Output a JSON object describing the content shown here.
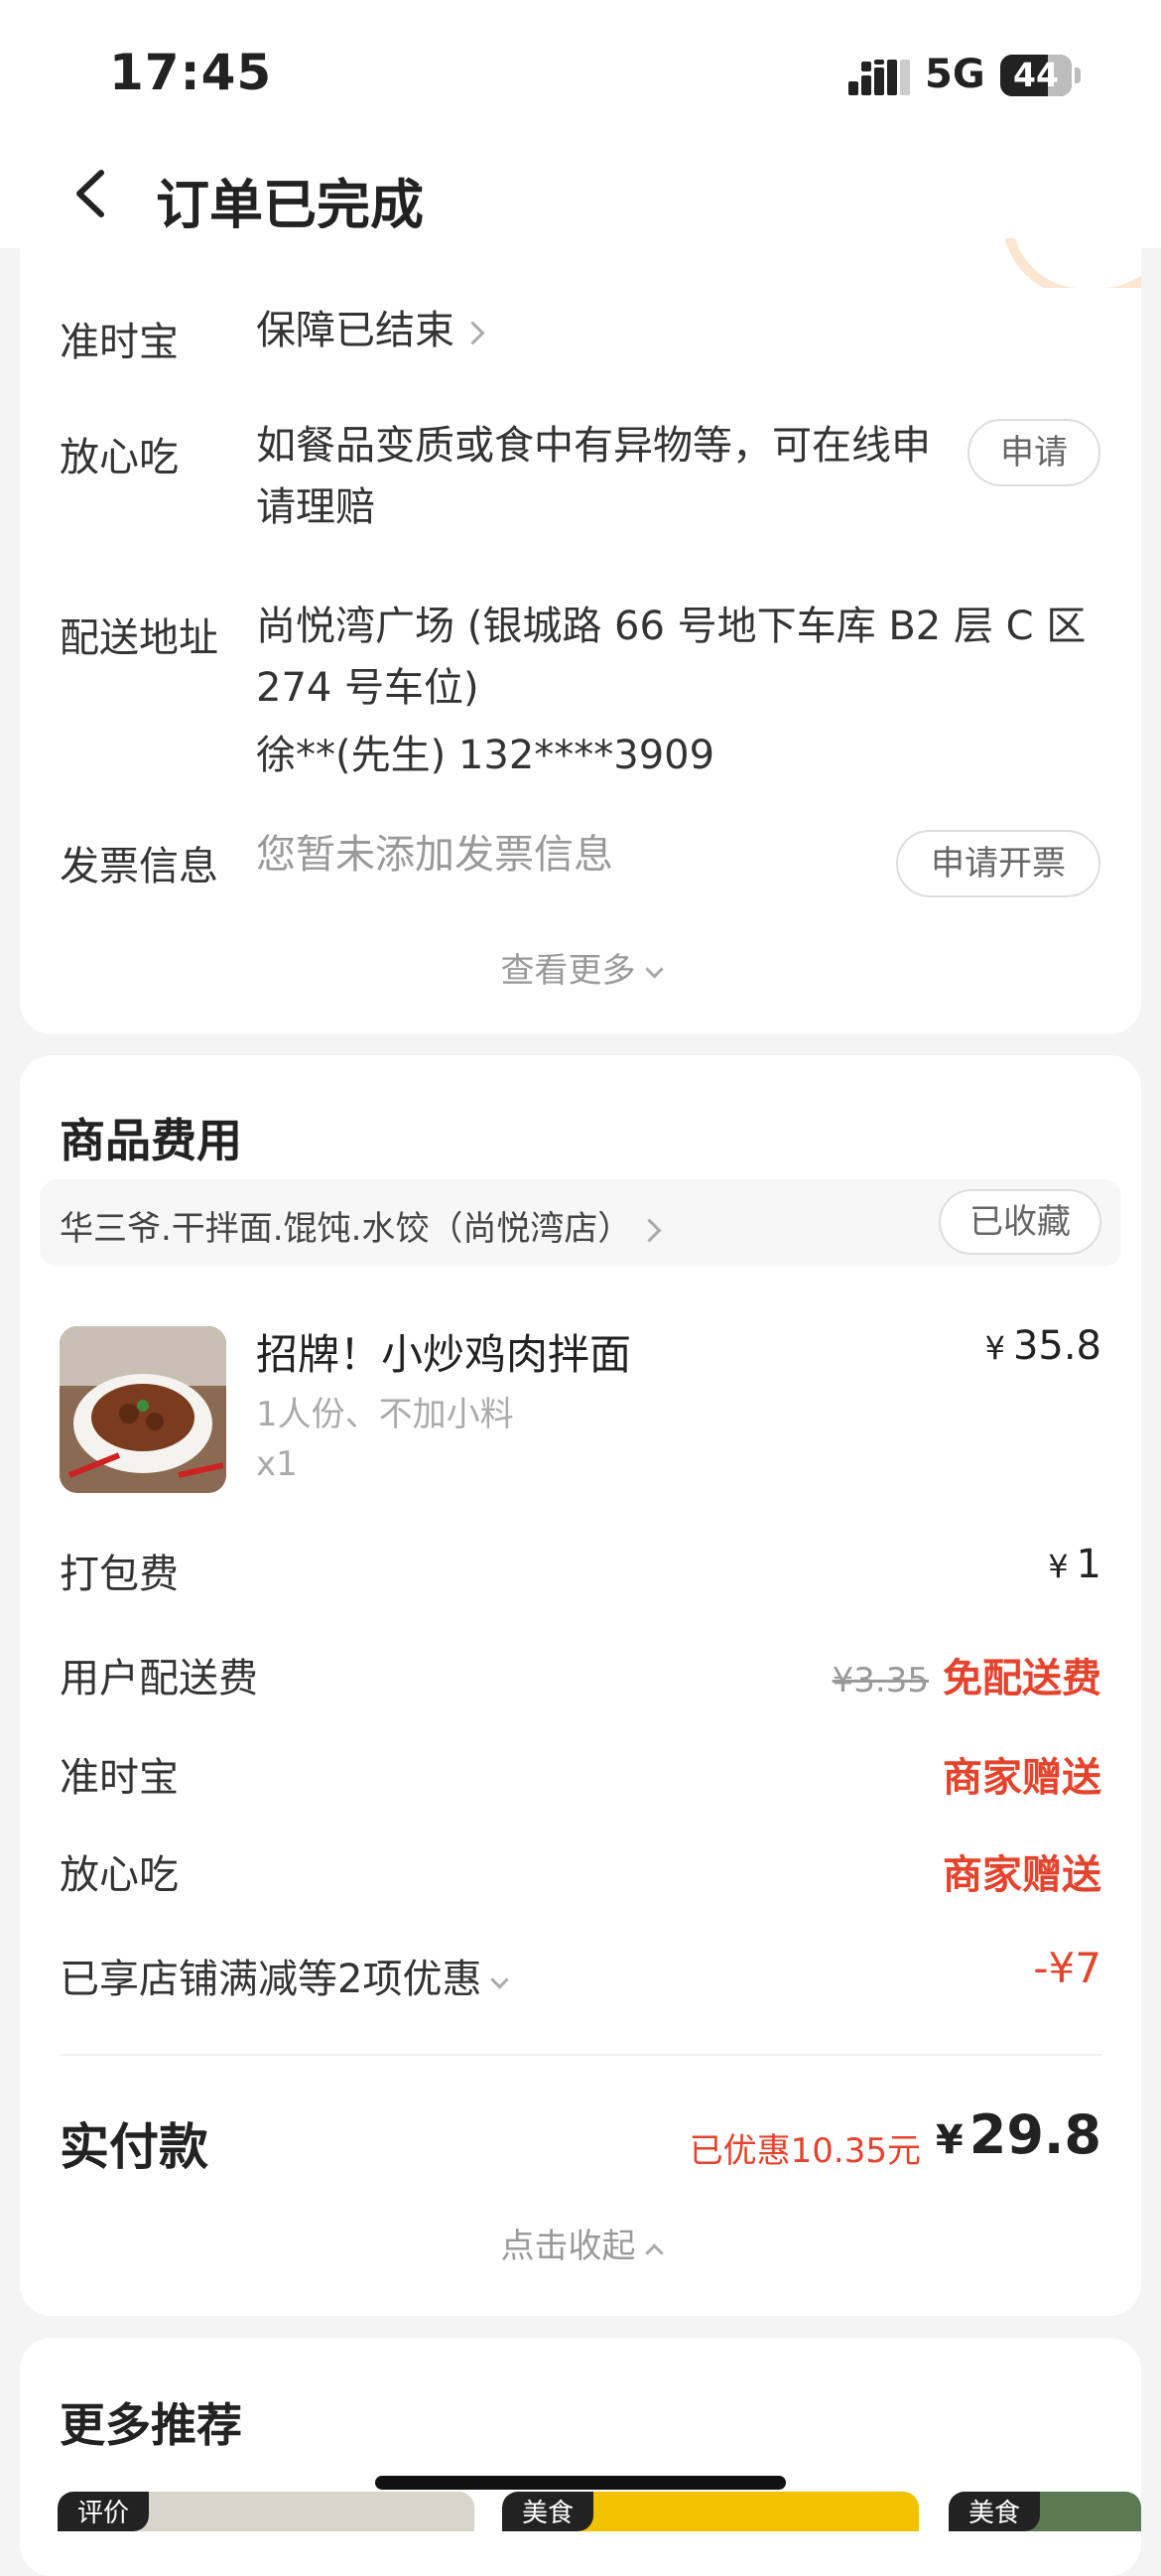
{
  "status_bar": {
    "time": "17:45",
    "network": "5G",
    "battery": "44"
  },
  "nav": {
    "title": "订单已完成"
  },
  "details": {
    "ontime": {
      "label": "准时宝",
      "value": "保障已结束"
    },
    "assurance": {
      "label": "放心吃",
      "value": "如餐品变质或食中有异物等，可在线申请理赔",
      "button": "申请"
    },
    "address": {
      "label": "配送地址",
      "line1": "尚悦湾广场 (银城路 66 号地下车库 B2 层 C 区 274 号车位)",
      "line2": "徐**(先生) 132****3909"
    },
    "invoice": {
      "label": "发票信息",
      "value": "您暂未添加发票信息",
      "button": "申请开票"
    },
    "more_link": "查看更多"
  },
  "goods": {
    "title": "商品费用",
    "shop_name": "华三爷.干拌面.馄饨.水饺（尚悦湾店）",
    "fav_button": "已收藏",
    "item": {
      "name": "招牌！小炒鸡肉拌面",
      "spec": "1人份、不加小料",
      "qty": "x1",
      "currency": "¥",
      "price": "35.8"
    },
    "packing": {
      "label": "打包费",
      "currency": "¥",
      "value": "1"
    },
    "delivery": {
      "label": "用户配送费",
      "original": "¥3.35",
      "value": "免配送费"
    },
    "ontime": {
      "label": "准时宝",
      "value": "商家赠送"
    },
    "assurance": {
      "label": "放心吃",
      "value": "商家赠送"
    },
    "discount": {
      "label": "已享店铺满减等2项优惠",
      "value": "-¥7"
    },
    "paid": {
      "label": "实付款",
      "saved": "已优惠10.35元",
      "currency": "¥",
      "total": "29.8"
    },
    "collapse_link": "点击收起"
  },
  "recommend": {
    "title": "更多推荐",
    "tags": [
      "评价",
      "美食",
      "美食"
    ]
  }
}
